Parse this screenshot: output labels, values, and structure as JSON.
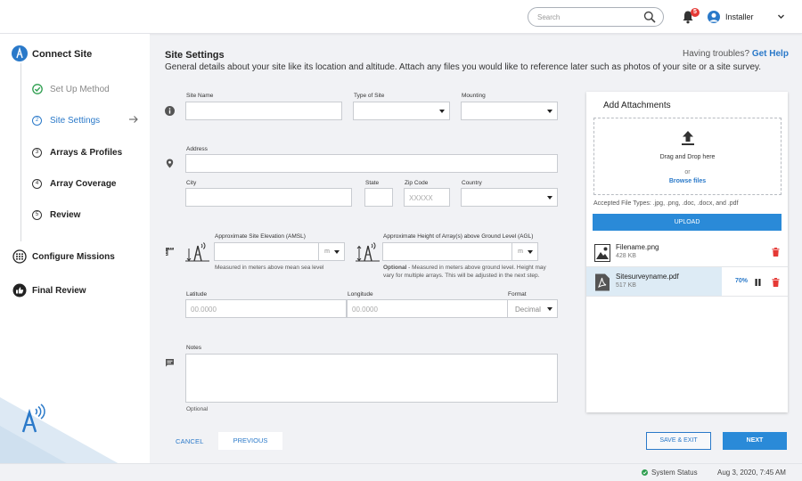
{
  "header": {
    "search_placeholder": "Search",
    "notification_count": "5",
    "user_name": "Installer"
  },
  "sidebar": {
    "title": "Connect Site",
    "steps": [
      {
        "number": "",
        "label": "Set Up Method",
        "state": "done"
      },
      {
        "number": "2",
        "label": "Site Settings",
        "state": "active"
      },
      {
        "number": "3",
        "label": "Arrays & Profiles",
        "state": "pending"
      },
      {
        "number": "4",
        "label": "Array Coverage",
        "state": "pending"
      },
      {
        "number": "5",
        "label": "Review",
        "state": "pending"
      }
    ],
    "sections": [
      {
        "label": "Configure Missions",
        "icon": "grid-dots-icon"
      },
      {
        "label": "Final Review",
        "icon": "thumbs-up-icon"
      }
    ]
  },
  "page": {
    "title": "Site Settings",
    "description": "General details about your site like its location and altitude. Attach any files you would like to reference later such as photos of your site or a site survey.",
    "help_prefix": "Having troubles?",
    "help_link": "Get Help"
  },
  "form": {
    "site_name_label": "Site Name",
    "type_of_site_label": "Type of Site",
    "mounting_label": "Mounting",
    "address_label": "Address",
    "city_label": "City",
    "state_label": "State",
    "zip_label": "Zip Code",
    "zip_placeholder": "XXXXX",
    "country_label": "Country",
    "elevation_label": "Approximate Site Elevation (AMSL)",
    "elevation_unit": "m",
    "elevation_hint": "Measured in meters above mean sea level",
    "height_label": "Approximate Height of Array(s) above Ground Level (AGL)",
    "height_unit": "m",
    "height_hint_bold": "Optional",
    "height_hint": " - Measured in meters above ground level. Height may vary for multiple arrays. This will be adjusted in the next step.",
    "latitude_label": "Latitude",
    "latitude_placeholder": "00.0000",
    "longitude_label": "Longitude",
    "longitude_placeholder": "00.0000",
    "format_label": "Format",
    "format_value": "Decimal",
    "notes_label": "Notes",
    "notes_hint": "Optional"
  },
  "attachments": {
    "title": "Add Attachments",
    "drop_text": "Drag and Drop here",
    "or_text": "or",
    "browse_text": "Browse files",
    "accepted_types": "Accepted File Types: .jpg, .png, .doc, .docx, and .pdf",
    "upload_label": "UPLOAD",
    "files": [
      {
        "name": "Filename.png",
        "size": "428 KB",
        "icon": "image-file-icon"
      },
      {
        "name": "Sitesurveyname.pdf",
        "size": "517 KB",
        "icon": "pdf-file-icon",
        "progress": "70%"
      }
    ]
  },
  "footer_buttons": {
    "cancel": "CANCEL",
    "previous": "PREVIOUS",
    "save_exit": "SAVE & EXIT",
    "next": "NEXT"
  },
  "statusbar": {
    "status": "System Status",
    "datetime": "Aug 3, 2020,  7:45 AM",
    "status_color": "#2e9e4f"
  },
  "colors": {
    "accent": "#2a79c9",
    "button_primary": "#2a8ad8",
    "delete": "#e53935"
  }
}
